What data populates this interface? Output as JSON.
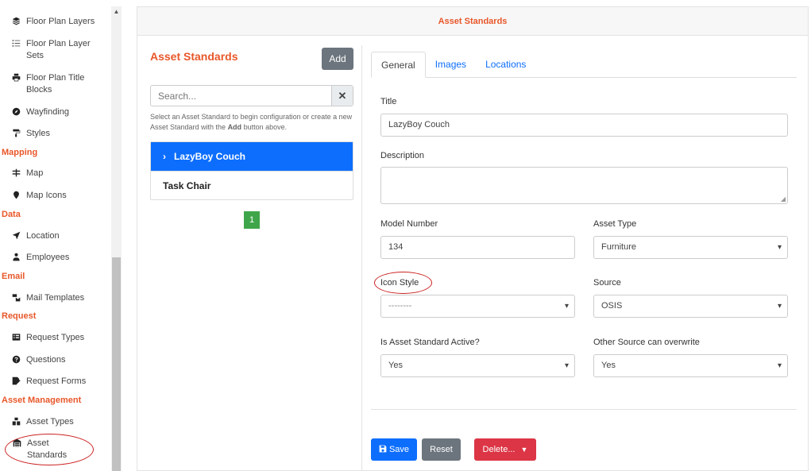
{
  "sidebar": {
    "top_items": [
      {
        "label": "Floor Plan Layers",
        "icon": "layers-icon"
      },
      {
        "label": "Floor Plan Layer Sets",
        "icon": "list-icon"
      },
      {
        "label": "Floor Plan Title Blocks",
        "icon": "print-icon"
      },
      {
        "label": "Wayfinding",
        "icon": "compass-icon"
      },
      {
        "label": "Styles",
        "icon": "paint-roller-icon"
      }
    ],
    "sections": {
      "mapping": "Mapping",
      "data": "Data",
      "email": "Email",
      "request": "Request",
      "asset_management": "Asset Management"
    },
    "mapping_items": [
      {
        "label": "Map",
        "icon": "signpost-icon"
      },
      {
        "label": "Map Icons",
        "icon": "map-marker-icon"
      }
    ],
    "data_items": [
      {
        "label": "Location",
        "icon": "location-arrow-icon"
      },
      {
        "label": "Employees",
        "icon": "user-tie-icon"
      }
    ],
    "email_items": [
      {
        "label": "Mail Templates",
        "icon": "mail-bulk-icon"
      }
    ],
    "request_items": [
      {
        "label": "Request Types",
        "icon": "list-alt-icon"
      },
      {
        "label": "Questions",
        "icon": "question-circle-icon"
      },
      {
        "label": "Request Forms",
        "icon": "file-signature-icon"
      }
    ],
    "asset_items": [
      {
        "label": "Asset Types",
        "icon": "cubes-icon"
      },
      {
        "label": "Asset Standards",
        "icon": "warehouse-icon"
      }
    ]
  },
  "page": {
    "header_title": "Asset Standards"
  },
  "list_pane": {
    "title": "Asset Standards",
    "add_label": "Add",
    "search_placeholder": "Search...",
    "hint_before": "Select an Asset Standard to begin configuration or create a new Asset Standard with the ",
    "hint_bold": "Add",
    "hint_after": " button above.",
    "items": [
      {
        "label": "LazyBoy Couch",
        "active": true
      },
      {
        "label": "Task Chair",
        "active": false
      }
    ],
    "page_number": "1"
  },
  "detail": {
    "tabs": [
      {
        "label": "General",
        "active": true
      },
      {
        "label": "Images",
        "active": false
      },
      {
        "label": "Locations",
        "active": false
      }
    ],
    "title_label": "Title",
    "title_value": "LazyBoy Couch",
    "description_label": "Description",
    "model_number_label": "Model Number",
    "model_number_value": "134",
    "asset_type_label": "Asset Type",
    "asset_type_value": "Furniture",
    "icon_style_label": "Icon Style",
    "icon_style_value": "--------",
    "source_label": "Source",
    "source_value": "OSIS",
    "active_label": "Is Asset Standard Active?",
    "active_value": "Yes",
    "overwrite_label": "Other Source can overwrite",
    "overwrite_value": "Yes"
  },
  "footer": {
    "save_label": "Save",
    "reset_label": "Reset",
    "delete_label": "Delete..."
  },
  "colors": {
    "accent_orange": "#e8572a",
    "primary_blue": "#0d6efd",
    "danger_red": "#dc3545",
    "secondary_gray": "#6c757d",
    "pager_green": "#3fa54a",
    "annotation_red": "#cc2222"
  }
}
